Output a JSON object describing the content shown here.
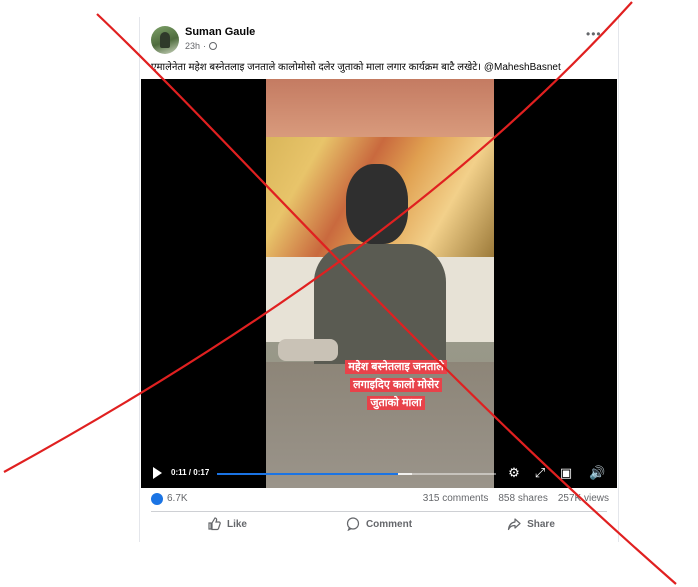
{
  "post": {
    "author": "Suman Gaule",
    "time": "23h",
    "caption": "एमालेनेता महेश बस्नेतलाइ जनताले कालोमोसो दलेर जुताको माला लगार कार्यक्रम बाटै लखेटे। @MaheshBasnet"
  },
  "video": {
    "subtitle_lines": [
      "महेश बस्नेतलाइ जनताले",
      "लगाइदिए कालो मोसेर",
      "जुताको माला"
    ],
    "current_time": "0:11",
    "duration": "0:17",
    "progress_fraction": 0.647,
    "buffer_fraction": 0.7
  },
  "stats": {
    "reactions": "6.7K",
    "comments": "315 comments",
    "shares": "858 shares",
    "views": "257K views"
  },
  "actions": {
    "like": "Like",
    "comment": "Comment",
    "share": "Share"
  },
  "colors": {
    "accent": "#1b74e4",
    "subtitle_bg": "#e8424a",
    "cross_lines": "#e02020"
  },
  "icons": [
    "globe-icon",
    "more-icon",
    "play-icon",
    "settings-icon",
    "fullscreen-icon",
    "miniplayer-icon",
    "volume-icon",
    "like-icon",
    "comment-icon",
    "share-icon"
  ]
}
